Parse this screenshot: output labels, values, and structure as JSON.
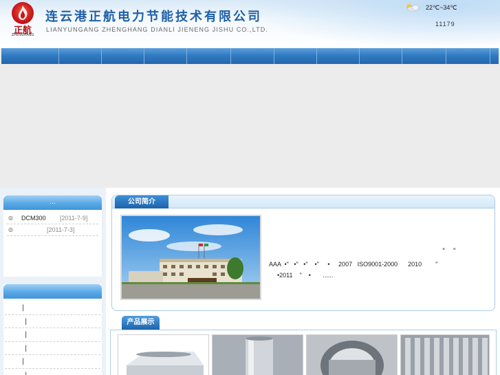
{
  "header": {
    "company_name_cn": "连云港正航电力节能技术有限公司",
    "company_name_en": "LIANYUNGANG ZHENGHANG DIANLI JIENENG JISHU CO.,LTD.",
    "logo_mark": "正航",
    "logo_text": "ZHENGHANG",
    "weather_icon": "partly-cloudy-icon",
    "temperature": "22℃~34℃",
    "counter": "11179"
  },
  "nav": {
    "item_count": 12
  },
  "sidebar": {
    "news_title": "...",
    "news": [
      {
        "bullet": "◎",
        "title": "DCM300",
        "date": "[2011-7-9]"
      },
      {
        "bullet": "◎",
        "title": "",
        "date": "[2011-7-3]"
      }
    ],
    "categories_title": "",
    "categories": [
      {
        "label": "|"
      },
      {
        "label": "|"
      },
      {
        "label": "|"
      },
      {
        "label": "|"
      },
      {
        "label": "|"
      },
      {
        "label": "|"
      }
    ]
  },
  "about": {
    "title": "公司简介",
    "quote_marks": "\"    \"",
    "line1": "AAA  •\"   •\"   •\"    •\"     •     2007   ISO9001-2000      2010        \"",
    "line2": "•2011    \"    •       ......"
  },
  "products": {
    "title": "产品展示"
  },
  "colors": {
    "brand_blue": "#1f5fa8",
    "nav_blue": "#2f78c0",
    "accent_light": "#5aa8e6"
  }
}
